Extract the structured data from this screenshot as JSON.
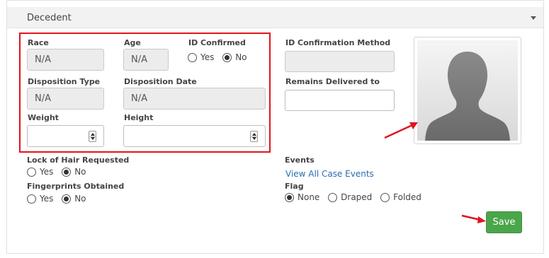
{
  "section": {
    "title": "Decedent"
  },
  "fields": {
    "race": {
      "label": "Race",
      "value": "N/A"
    },
    "age": {
      "label": "Age",
      "value": "N/A"
    },
    "id_confirmed": {
      "label": "ID Confirmed",
      "options": [
        "Yes",
        "No"
      ],
      "selected": "No"
    },
    "id_confirmation_method": {
      "label": "ID Confirmation Method",
      "value": ""
    },
    "disposition_type": {
      "label": "Disposition Type",
      "value": "N/A"
    },
    "disposition_date": {
      "label": "Disposition Date",
      "value": "N/A"
    },
    "remains_delivered_to": {
      "label": "Remains Delivered to",
      "value": ""
    },
    "weight": {
      "label": "Weight",
      "value": ""
    },
    "height": {
      "label": "Height",
      "value": ""
    },
    "lock_of_hair": {
      "label": "Lock of Hair Requested",
      "options": [
        "Yes",
        "No"
      ],
      "selected": "No"
    },
    "fingerprints": {
      "label": "Fingerprints Obtained",
      "options": [
        "Yes",
        "No"
      ],
      "selected": "No"
    },
    "events": {
      "label": "Events",
      "link": "View All Case Events"
    },
    "flag": {
      "label": "Flag",
      "options": [
        "None",
        "Draped",
        "Folded"
      ],
      "selected": "None"
    }
  },
  "photo": {
    "icon": "person-silhouette-icon"
  },
  "actions": {
    "save_label": "Save"
  },
  "colors": {
    "highlight": "#e0151d",
    "save": "#4aa64a",
    "link": "#2a6bb0"
  }
}
